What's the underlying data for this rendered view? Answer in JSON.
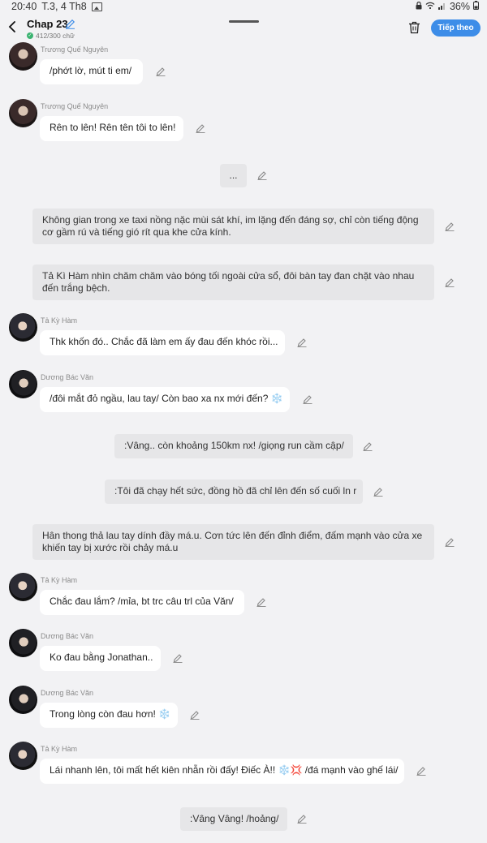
{
  "status_bar": {
    "time": "20:40",
    "date": "T.3, 4 Th8",
    "battery": "36%"
  },
  "header": {
    "title": "Chap 23",
    "word_count": "412/300 chữ",
    "next_button": "Tiếp theo"
  },
  "messages": [
    {
      "type": "character",
      "sender": "Trương Quế Nguyên",
      "text": "/phớt lờ, mút ti em/"
    },
    {
      "type": "character",
      "sender": "Trương Quế Nguyên",
      "text": "Rên to lên! Rên tên tôi to lên!"
    },
    {
      "type": "narration",
      "text": "..."
    },
    {
      "type": "narration",
      "text": "Không gian trong xe taxi nồng nặc mùi sát khí, im lặng đến đáng sợ, chỉ còn tiếng động cơ gầm rú và tiếng gió rít qua khe cửa kính."
    },
    {
      "type": "narration",
      "text": "Tả Kì Hàm nhìn chăm chăm vào bóng tối ngoài cửa sổ, đôi bàn tay đan chặt vào nhau đến trắng bệch."
    },
    {
      "type": "character",
      "sender": "Tả Kỳ Hàm",
      "text": "Thk khốn đó.. Chắc đã làm em ấy đau đến khóc rồi..."
    },
    {
      "type": "character",
      "sender": "Dương Bác Văn",
      "text": "/đôi mắt đỏ ngầu, lau tay/ Còn bao xa nx mới đến? ❄️"
    },
    {
      "type": "narration",
      "text": ":Vâng.. còn khoảng 150km nx! /giọng run cầm cập/"
    },
    {
      "type": "narration",
      "text": ":Tôi đã chạy hết sức, đồng hồ đã chỉ lên đến số cuối ln r"
    },
    {
      "type": "narration",
      "text": "Hân thong thả lau tay dính đầy má.u. Cơn tức lên đến đỉnh điểm, đấm mạnh vào cửa xe khiến tay  bị xước rồi chảy má.u"
    },
    {
      "type": "character",
      "sender": "Tả Kỳ Hàm",
      "text": "Chắc đau lắm? /mỉa, bt trc câu trl của Văn/"
    },
    {
      "type": "character",
      "sender": "Dương Bác Văn",
      "text": "Ko đau bằng Jonathan.."
    },
    {
      "type": "character",
      "sender": "Dương Bác Văn",
      "text": "Trong lòng còn đau hơn! ❄️"
    },
    {
      "type": "character",
      "sender": "Tả Kỳ Hàm",
      "text": "Lái nhanh lên, tôi mất hết kiên nhẫn rồi đấy! Điếc À!! ❄️💢 /đá mạnh vào ghế lái/"
    },
    {
      "type": "narration",
      "text": ":Vâng Vâng! /hoảng/"
    }
  ]
}
